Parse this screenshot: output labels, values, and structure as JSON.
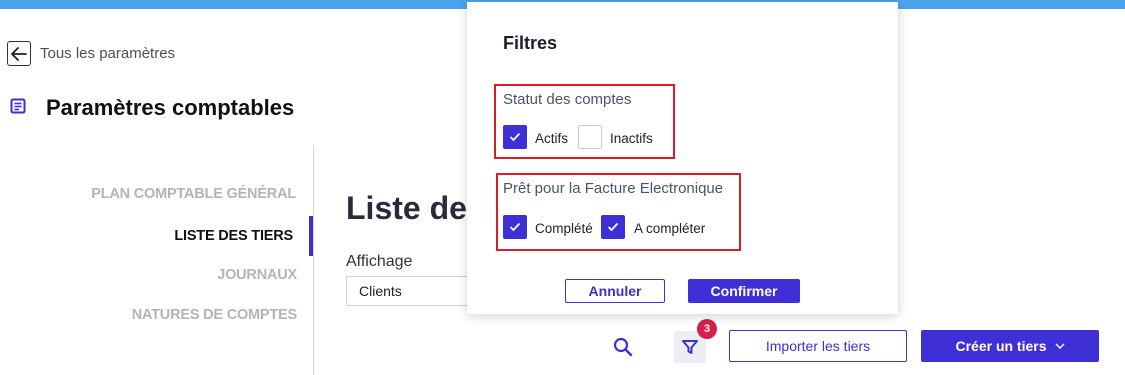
{
  "header": {
    "back_label": "Tous les paramètres",
    "page_title": "Paramètres comptables"
  },
  "sidebar": {
    "items": [
      {
        "label": "PLAN COMPTABLE GÉNÉRAL",
        "active": false
      },
      {
        "label": "LISTE DES TIERS",
        "active": true
      },
      {
        "label": "JOURNAUX",
        "active": false
      },
      {
        "label": "NATURES DE COMPTES",
        "active": false
      }
    ]
  },
  "main": {
    "title": "Liste des",
    "affichage_label": "Affichage",
    "affichage_value": "Clients"
  },
  "toolbar": {
    "filter_badge": "3",
    "import_label": "Importer les tiers",
    "create_label": "Créer un tiers"
  },
  "filters": {
    "title": "Filtres",
    "groups": [
      {
        "label": "Statut des comptes",
        "options": [
          {
            "label": "Actifs",
            "checked": true
          },
          {
            "label": "Inactifs",
            "checked": false
          }
        ]
      },
      {
        "label": "Prêt pour la Facture Electronique",
        "options": [
          {
            "label": "Complété",
            "checked": true
          },
          {
            "label": "A compléter",
            "checked": true
          }
        ]
      }
    ],
    "cancel_label": "Annuler",
    "confirm_label": "Confirmer"
  },
  "colors": {
    "accent": "#3f2fd6",
    "top_bar": "#4aa3ea",
    "badge": "#d81e4a",
    "highlight_border": "#d81e2a"
  },
  "icons": [
    "arrow-left-icon",
    "document-icon",
    "search-icon",
    "filter-icon",
    "chevron-down-icon",
    "checkmark-icon"
  ]
}
